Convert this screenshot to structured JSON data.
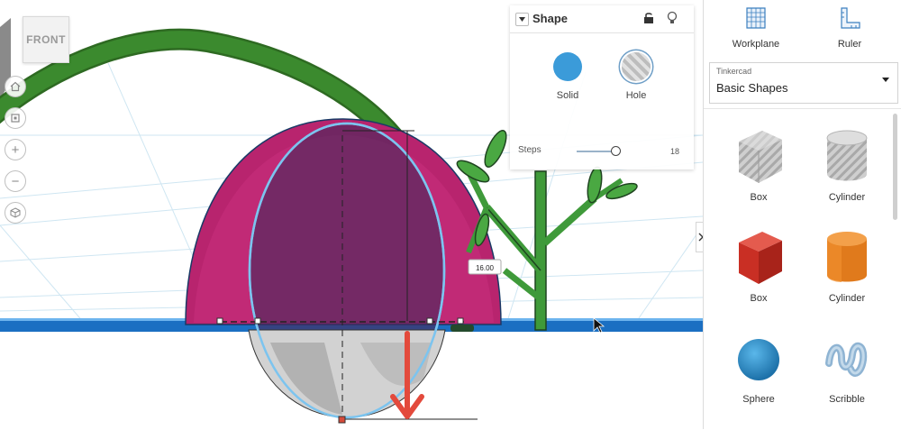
{
  "navcube": {
    "label": "FRONT"
  },
  "dimension": {
    "value": "16.00"
  },
  "shape_panel": {
    "title": "Shape",
    "solid_label": "Solid",
    "hole_label": "Hole",
    "steps_label": "Steps",
    "steps_value": "18",
    "steps_level": 0.9
  },
  "toolbar": {
    "workplane_label": "Workplane",
    "ruler_label": "Ruler"
  },
  "library": {
    "source": "Tinkercad",
    "selected": "Basic Shapes"
  },
  "shapes": [
    {
      "label": "Box",
      "icon": "box-hole-icon"
    },
    {
      "label": "Cylinder",
      "icon": "cylinder-hole-icon"
    },
    {
      "label": "Box",
      "icon": "box-solid-icon"
    },
    {
      "label": "Cylinder",
      "icon": "cylinder-solid-icon"
    },
    {
      "label": "Sphere",
      "icon": "sphere-icon"
    },
    {
      "label": "Scribble",
      "icon": "scribble-icon"
    }
  ],
  "colors": {
    "solid": "#3b9bd9",
    "dome": "#b8246e",
    "stem": "#3b8a2e",
    "arrow": "#e34a3c",
    "workplane": "#1b6fc2"
  }
}
